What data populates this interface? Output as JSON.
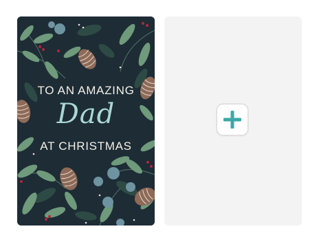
{
  "card": {
    "line1": "TO AN AMAZING",
    "line2": "Dad",
    "line3": "AT CHRISTMAS"
  },
  "add_button": {
    "icon": "plus-icon",
    "color": "#3aa9a6"
  },
  "colors": {
    "card_background": "#1d2c35",
    "leaf_green": "#6f9a7c",
    "leaf_green_dark": "#3d5f50",
    "leaf_blue": "#6e93a1",
    "berry_red": "#b8243a",
    "pinecone_brown": "#8e6a58",
    "text_cream": "#f4efe6",
    "text_script": "#a9d8d4",
    "empty_panel": "#f3f3f3"
  }
}
